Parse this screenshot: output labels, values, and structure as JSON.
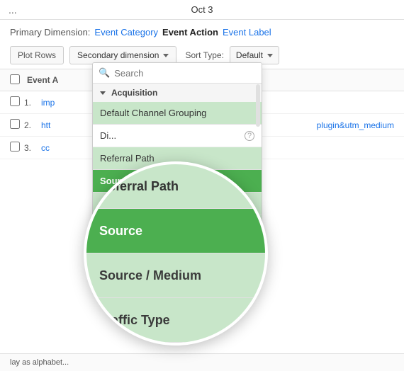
{
  "topbar": {
    "dots": "...",
    "title": "Oct 3"
  },
  "primary": {
    "label": "Primary Dimension:",
    "items": [
      {
        "id": "event-category",
        "text": "Event Category",
        "active": false
      },
      {
        "id": "event-action",
        "text": "Event Action",
        "active": true
      },
      {
        "id": "event-label",
        "text": "Event Label",
        "active": false
      }
    ]
  },
  "toolbar": {
    "plot_rows": "Plot Rows",
    "secondary_dim": "Secondary dimension",
    "sort_type_label": "Sort Type:",
    "sort_type_value": "Default"
  },
  "table": {
    "col_header": "Event A",
    "rows": [
      {
        "num": "1.",
        "link": "imp",
        "extra": ""
      },
      {
        "num": "2.",
        "link": "htt",
        "extra": "plugin&utm_medium"
      },
      {
        "num": "3.",
        "link": "cc",
        "extra": ""
      }
    ]
  },
  "dropdown": {
    "search_placeholder": "Search",
    "section": "Acquisition",
    "items": [
      {
        "id": "default-channel",
        "text": "Default Channel Grouping",
        "state": "highlight"
      },
      {
        "id": "dimension",
        "text": "Di...",
        "state": "normal",
        "has_help": true
      },
      {
        "id": "referral-path",
        "text": "Referral Path",
        "state": "magnified"
      },
      {
        "id": "source",
        "text": "Source",
        "state": "active"
      },
      {
        "id": "source-medium",
        "text": "Source / Medium",
        "state": "magnified-bottom"
      },
      {
        "id": "traffic-type",
        "text": "Traffic Type",
        "state": "magnified-last"
      }
    ]
  },
  "bottombar": {
    "text": "lay as alphabet..."
  },
  "icons": {
    "search": "🔍",
    "triangle_down": "▼",
    "chevron_right": "▶",
    "question": "?"
  }
}
